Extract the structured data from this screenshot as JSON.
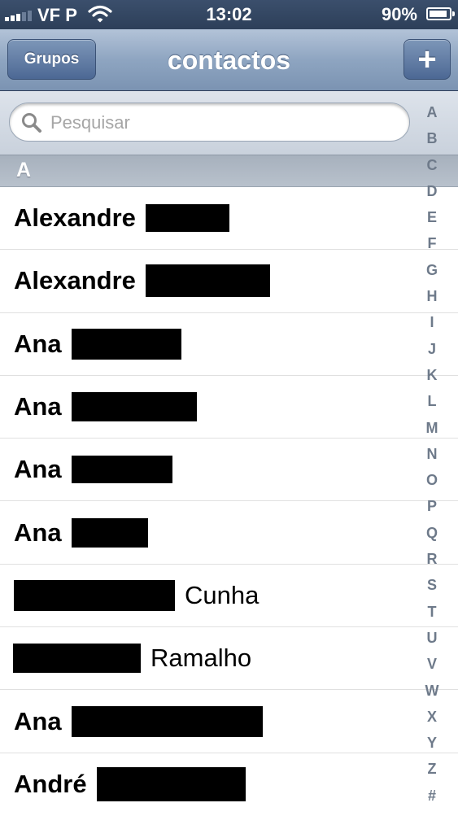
{
  "status_bar": {
    "carrier": "VF P",
    "time": "13:02",
    "battery": "90%",
    "battery_level": 0.9,
    "signal_bars_filled": 3,
    "signal_bars_total": 5
  },
  "nav": {
    "title": "contactos",
    "groups_label": "Grupos",
    "add_label": "+"
  },
  "search": {
    "placeholder": "Pesquisar",
    "value": ""
  },
  "section": {
    "letter": "A"
  },
  "contacts": [
    {
      "first": "Alexandre",
      "last": ""
    },
    {
      "first": "Alexandre",
      "last": ""
    },
    {
      "first": "Ana",
      "last": ""
    },
    {
      "first": "Ana",
      "last": ""
    },
    {
      "first": "Ana",
      "last": ""
    },
    {
      "first": "Ana",
      "last": ""
    },
    {
      "first": "",
      "last": "Cunha"
    },
    {
      "first": "",
      "last": "Ramalho"
    },
    {
      "first": "Ana",
      "last": ""
    },
    {
      "first": "André",
      "last": ""
    }
  ],
  "index_letters": [
    "A",
    "B",
    "C",
    "D",
    "E",
    "F",
    "G",
    "H",
    "I",
    "J",
    "K",
    "L",
    "M",
    "N",
    "O",
    "P",
    "Q",
    "R",
    "S",
    "T",
    "U",
    "V",
    "W",
    "X",
    "Y",
    "Z",
    "#"
  ],
  "colors": {
    "nav_gradient_top": "#b3c3d8",
    "nav_gradient_bottom": "#7b93b2",
    "index_text": "#6e7a8a",
    "redaction": "#000000"
  }
}
